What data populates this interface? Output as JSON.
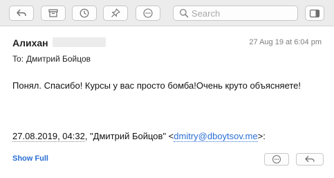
{
  "toolbar": {
    "buttons": [
      {
        "name": "reply-icon"
      },
      {
        "name": "archive-icon"
      },
      {
        "name": "clock-icon"
      },
      {
        "name": "pin-icon"
      },
      {
        "name": "more-icon"
      }
    ],
    "search_placeholder": "Search",
    "sidebar_toggle": "sidebar-icon"
  },
  "message": {
    "sender": "Алихан",
    "date": "27 Aug 19 at 6:04 pm",
    "to_label": "To:",
    "to_name": "Дмитрий Бойцов",
    "body": "Понял. Спасибо! Курсы у вас просто бомба!Очень круто объясняете!",
    "quote_date": "27.08.2019, 04:32",
    "quote_middle": ", \"Дмитрий Бойцов\" <",
    "quote_email": "dmitry@dboytsov.me",
    "quote_end": ">:",
    "show_full": "Show Full"
  },
  "colors": {
    "accent": "#2a6fd6",
    "toolbar_bg": "#ececec"
  }
}
